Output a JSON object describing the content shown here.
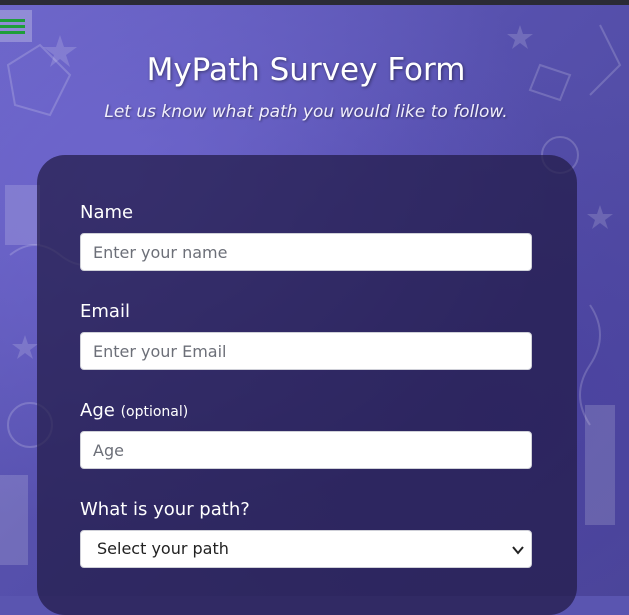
{
  "nav": {
    "menu_icon": "hamburger-menu-icon",
    "icon_color": "#1e9e3a"
  },
  "header": {
    "title": "MyPath Survey Form",
    "subtitle": "Let us know what path you would like to follow."
  },
  "form": {
    "name": {
      "label": "Name",
      "placeholder": "Enter your name"
    },
    "email": {
      "label": "Email",
      "placeholder": "Enter your Email"
    },
    "age": {
      "label": "Age",
      "optional": "(optional)",
      "placeholder": "Age"
    },
    "path": {
      "label": "What is your path?",
      "selected": "Select your path",
      "icon": "chevron-down-icon"
    }
  },
  "colors": {
    "background": "#5a55b0",
    "card": "#211a46",
    "text": "#ffffff"
  }
}
